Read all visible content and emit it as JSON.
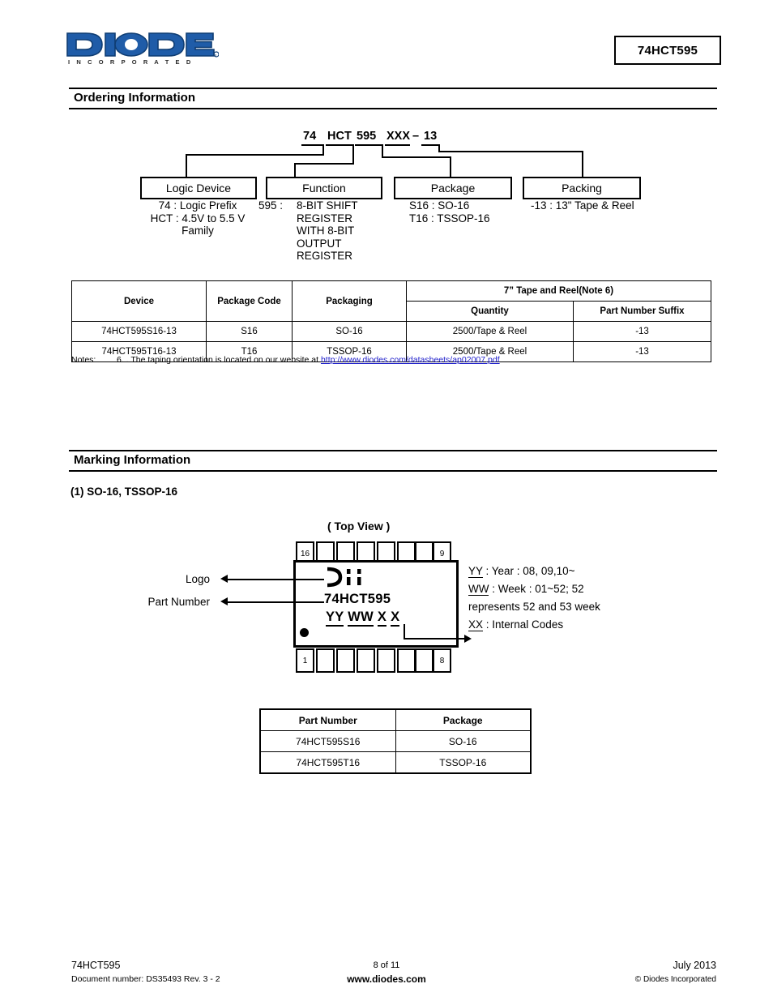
{
  "header": {
    "logo_text": "DIODES",
    "logo_subtext": "I N C O R P O R A T E D",
    "part_number": "74HCT595"
  },
  "ordering": {
    "section_title": "Ordering Information",
    "code_parts": {
      "prefix": "74",
      "family": "HCT",
      "function": "595",
      "package": "XXX",
      "dash": "–",
      "packing": "13"
    },
    "categories": [
      {
        "box_label": "Logic Device",
        "desc": "74 : Logic Prefix\nHCT :  4.5V to 5.5 V\nFamily"
      },
      {
        "box_label": "Function",
        "desc_key": "595 :",
        "desc": "8-BIT SHIFT\nREGISTER\nWITH 8-BIT\nOUTPUT\nREGISTER"
      },
      {
        "box_label": "Package",
        "desc": "S16 :  SO-16\nT16 :  TSSOP-16"
      },
      {
        "box_label": "Packing",
        "desc": "-13 : 13\" Tape & Reel"
      }
    ],
    "table": {
      "headers": {
        "device": "Device",
        "package_code": "Package Code",
        "packaging": "Packaging",
        "tape_reel": "7” Tape and Reel(Note 6)",
        "quantity": "Quantity",
        "suffix": "Part Number Suffix"
      },
      "rows": [
        {
          "device": "74HCT595S16-13",
          "package_code": "S16",
          "packaging": "SO-16",
          "quantity": "2500/Tape & Reel",
          "suffix": "-13"
        },
        {
          "device": "74HCT595T16-13",
          "package_code": "T16",
          "packaging": "TSSOP-16",
          "quantity": "2500/Tape & Reel",
          "suffix": "-13"
        }
      ]
    },
    "notes": {
      "label": "Notes:",
      "text": "6. . The taping orientation is located on our website at ",
      "link_text": "http://www.diodes.com/datasheets/ap02007.pdf"
    }
  },
  "marking": {
    "section_title": "Marking Information",
    "subhead": "(1) SO-16, TSSOP-16",
    "top_view": "( Top View )",
    "chip": {
      "part_text": "74HCT595",
      "date_code_yy": "YY",
      "date_code_ww": "WW",
      "date_code_x1": "X",
      "date_code_x2": "X",
      "pin_top_left": "16",
      "pin_top_right": "9",
      "pin_bottom_left": "1",
      "pin_bottom_right": "8"
    },
    "callouts": {
      "logo": "Logo",
      "part_number": "Part Number"
    },
    "legend": {
      "yy_key": "YY",
      "yy_text": " : Year : 08, 09,10~",
      "ww_key": "WW",
      "ww_text": " : Week : 01~52; 52",
      "ww_text2": "represents  52 and 53 week",
      "xx_key": "XX",
      "xx_text": " :  Internal Codes"
    },
    "table": {
      "headers": {
        "part_number": "Part Number",
        "package": "Package"
      },
      "rows": [
        {
          "part_number": "74HCT595S16",
          "package": "SO-16"
        },
        {
          "part_number": "74HCT595T16",
          "package": "TSSOP-16"
        }
      ]
    }
  },
  "footer": {
    "part_number": "74HCT595",
    "document_number": "Document number: DS35493 Rev. 3 - 2",
    "page": "8 of 11",
    "url": "www.diodes.com",
    "date": "July 2013",
    "copyright": "© Diodes Incorporated"
  },
  "colors": {
    "logo_blue": "#1F5CA8",
    "logo_navy": "#0F3D73",
    "link": "#2222cc"
  }
}
